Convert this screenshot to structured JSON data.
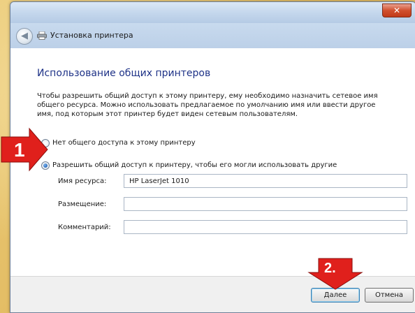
{
  "window": {
    "close_glyph": "✕",
    "nav_title": "Установка принтера"
  },
  "content": {
    "heading": "Использование общих принтеров",
    "description": "Чтобы разрешить общий доступ к этому принтеру, ему необходимо назначить сетевое имя общего ресурса. Можно использовать предлагаемое по умолчанию имя или ввести другое имя, под которым этот принтер будет виден сетевым пользователям.",
    "options": [
      {
        "label": "Нет общего доступа к этому принтеру",
        "selected": false
      },
      {
        "label": "Разрешить общий доступ к принтеру, чтобы его могли использовать другие",
        "selected": true
      }
    ],
    "fields": {
      "share_name": {
        "label": "Имя ресурса:",
        "value": "HP LaserJet 1010"
      },
      "location": {
        "label": "Размещение:",
        "value": ""
      },
      "comment": {
        "label": "Комментарий:",
        "value": ""
      }
    }
  },
  "footer": {
    "next_label": "Далее",
    "cancel_label": "Отмена"
  },
  "annotations": {
    "marker_1": "1",
    "marker_2": "2.",
    "color": "#e0201c"
  }
}
